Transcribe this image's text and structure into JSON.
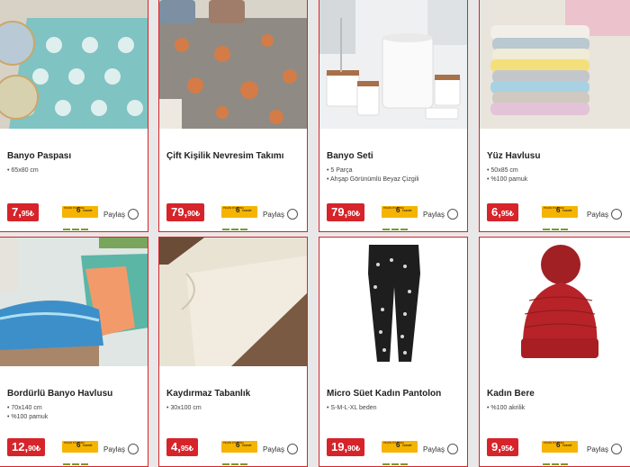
{
  "products": [
    {
      "title": "Banyo Paspası",
      "specs": [
        "65x80 cm"
      ],
      "price": "7,",
      "price_dec": "95",
      "currency": "₺",
      "share": "Paylaş"
    },
    {
      "title": "Çift Kişilik Nevresim Takımı",
      "specs": [],
      "price": "79,",
      "price_dec": "90",
      "currency": "₺",
      "share": "Paylaş"
    },
    {
      "title": "Banyo Seti",
      "specs": [
        "5 Parça",
        "Ahşap Görünümlü Beyaz Çizgili"
      ],
      "price": "79,",
      "price_dec": "90",
      "currency": "₺",
      "share": "Paylaş"
    },
    {
      "title": "Yüz Havlusu",
      "specs": [
        "50x85 cm",
        "%100 pamuk"
      ],
      "price": "6,",
      "price_dec": "95",
      "currency": "₺",
      "share": "Paylaş"
    },
    {
      "title": "Bordürlü Banyo Havlusu",
      "specs": [
        "70x140 cm",
        "%100 pamuk"
      ],
      "price": "12,",
      "price_dec": "90",
      "currency": "₺",
      "share": "Paylaş"
    },
    {
      "title": "Kaydırmaz Tabanlık",
      "specs": [
        "30x100 cm"
      ],
      "price": "4,",
      "price_dec": "95",
      "currency": "₺",
      "share": "Paylaş"
    },
    {
      "title": "Micro Süet Kadın Pantolon",
      "specs": [
        "S-M-L-XL beden"
      ],
      "price": "19,",
      "price_dec": "90",
      "currency": "₺",
      "share": "Paylaş"
    },
    {
      "title": "Kadın Bere",
      "specs": [
        "%100 akrilik"
      ],
      "price": "9,",
      "price_dec": "95",
      "currency": "₺",
      "share": "Paylaş"
    }
  ],
  "taksit": {
    "top": "PEŞİN FİYATINA",
    "num": "6",
    "word": "TAKSİT"
  },
  "colors": {
    "accent": "#d6242a",
    "badge": "#f5b400"
  }
}
